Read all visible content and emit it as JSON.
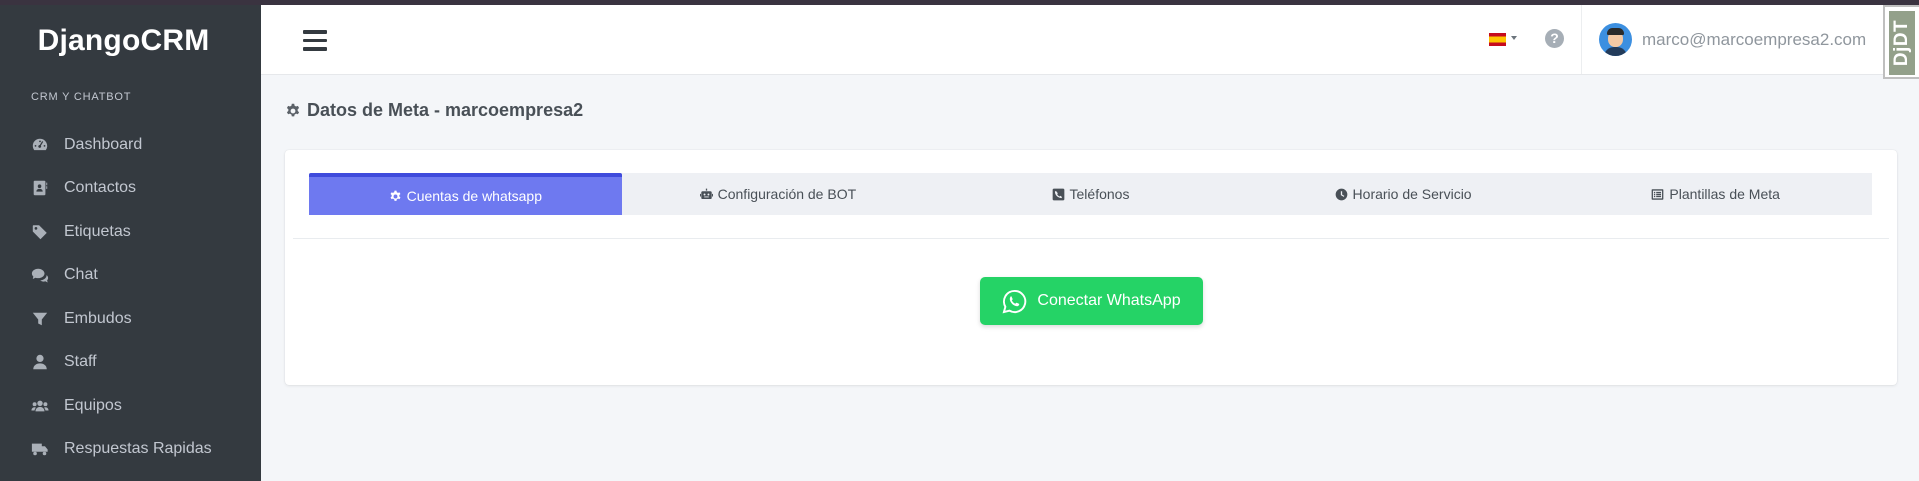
{
  "app": {
    "brand": "DjangoCRM"
  },
  "sidebar": {
    "section_header": "CRM Y CHATBOT",
    "items": [
      {
        "label": "Dashboard",
        "icon": "tachometer-icon"
      },
      {
        "label": "Contactos",
        "icon": "address-book-icon"
      },
      {
        "label": "Etiquetas",
        "icon": "tag-icon"
      },
      {
        "label": "Chat",
        "icon": "comments-icon"
      },
      {
        "label": "Embudos",
        "icon": "filter-icon"
      },
      {
        "label": "Staff",
        "icon": "user-icon"
      },
      {
        "label": "Equipos",
        "icon": "users-icon"
      },
      {
        "label": "Respuestas Rapidas",
        "icon": "truck-icon"
      }
    ]
  },
  "topnav": {
    "language_flag": "spain-flag-icon",
    "help_symbol": "?",
    "user_email": "marco@marcoempresa2.com"
  },
  "debug_toolbar": {
    "label": "DjDT"
  },
  "page": {
    "title": "Datos de Meta - marcoempresa2"
  },
  "tabs": [
    {
      "label": "Cuentas de whatsapp",
      "icon": "cog-icon",
      "active": true
    },
    {
      "label": "Configuración de BOT",
      "icon": "robot-icon",
      "active": false
    },
    {
      "label": "Teléfonos",
      "icon": "phone-square-icon",
      "active": false
    },
    {
      "label": "Horario de Servicio",
      "icon": "clock-icon",
      "active": false
    },
    {
      "label": "Plantillas de Meta",
      "icon": "list-alt-icon",
      "active": false
    }
  ],
  "whatsapp": {
    "connect_label": "Conectar WhatsApp"
  },
  "colors": {
    "sidebar_bg": "#343a40",
    "active_tab": "#6e79f0",
    "whatsapp_green": "#25d366",
    "page_bg": "#f4f6f9"
  }
}
